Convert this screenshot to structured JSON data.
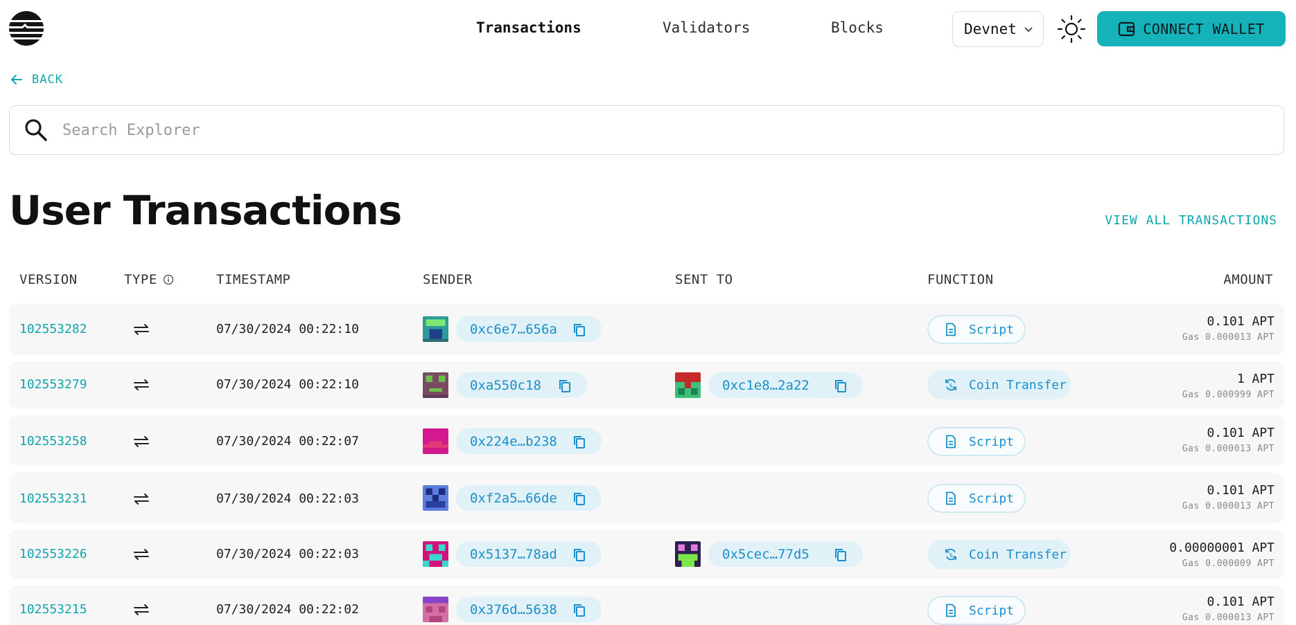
{
  "nav": {
    "links": [
      "Transactions",
      "Validators",
      "Blocks"
    ],
    "network": "Devnet",
    "connect_label": "CONNECT WALLET"
  },
  "back_label": "BACK",
  "search": {
    "placeholder": "Search Explorer"
  },
  "page_title": "User Transactions",
  "view_all_label": "VIEW ALL TRANSACTIONS",
  "table": {
    "headers": [
      "VERSION",
      "TYPE",
      "TIMESTAMP",
      "SENDER",
      "SENT TO",
      "FUNCTION",
      "AMOUNT"
    ],
    "rows": [
      {
        "version": "102553282",
        "timestamp": "07/30/2024 00:22:10",
        "sender": "0xc6e7…656a",
        "sent_to": "",
        "function": "Script",
        "amount": "0.101 APT",
        "gas": "Gas 0.000013 APT"
      },
      {
        "version": "102553279",
        "timestamp": "07/30/2024 00:22:10",
        "sender": "0xa550c18",
        "sent_to": "0xc1e8…2a22",
        "function": "Coin Transfer",
        "amount": "1 APT",
        "gas": "Gas 0.000999 APT"
      },
      {
        "version": "102553258",
        "timestamp": "07/30/2024 00:22:07",
        "sender": "0x224e…b238",
        "sent_to": "",
        "function": "Script",
        "amount": "0.101 APT",
        "gas": "Gas 0.000013 APT"
      },
      {
        "version": "102553231",
        "timestamp": "07/30/2024 00:22:03",
        "sender": "0xf2a5…66de",
        "sent_to": "",
        "function": "Script",
        "amount": "0.101 APT",
        "gas": "Gas 0.000013 APT"
      },
      {
        "version": "102553226",
        "timestamp": "07/30/2024 00:22:03",
        "sender": "0x5137…78ad",
        "sent_to": "0x5cec…77d5",
        "function": "Coin Transfer",
        "amount": "0.00000001 APT",
        "gas": "Gas 0.000009 APT"
      },
      {
        "version": "102553215",
        "timestamp": "07/30/2024 00:22:02",
        "sender": "0x376d…5638",
        "sent_to": "",
        "function": "Script",
        "amount": "0.101 APT",
        "gas": "Gas 0.000013 APT"
      }
    ]
  },
  "colors": {
    "accent": "#16b2ba",
    "link": "#0ea5ad",
    "pill_bg": "#e0f1f8",
    "pill_text": "#1b8fc9",
    "row_bg": "#f7f7f7"
  },
  "icons": {
    "logo": "aptos-logo-icon",
    "theme": "sun-icon",
    "wallet": "wallet-icon",
    "search": "search-icon",
    "back": "arrow-left-icon",
    "type": "transfer-arrows-icon",
    "copy": "copy-icon",
    "script": "document-icon",
    "coin_transfer": "refresh-coin-icon"
  }
}
